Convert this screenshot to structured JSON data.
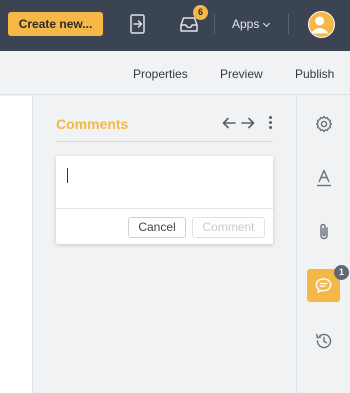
{
  "topbar": {
    "create_label": "Create new...",
    "notification_count": "6",
    "apps_label": "Apps",
    "icons": [
      "exit-icon",
      "inbox-icon",
      "chevron-down-icon",
      "avatar-icon"
    ]
  },
  "subnav": {
    "tabs": [
      "Properties",
      "Preview",
      "Publish"
    ]
  },
  "comments": {
    "title": "Comments",
    "input_value": "",
    "cancel_label": "Cancel",
    "comment_label": "Comment",
    "icons": [
      "arrow-left-icon",
      "arrow-right-icon",
      "more-vertical-icon"
    ]
  },
  "rail": {
    "comment_badge": "1",
    "icons": [
      "settings-icon",
      "text-format-icon",
      "attachment-icon",
      "comment-icon",
      "history-icon"
    ]
  },
  "colors": {
    "topbar_bg": "#3a4453",
    "accent": "#f5b847",
    "panel_bg": "#f1f2f4"
  }
}
